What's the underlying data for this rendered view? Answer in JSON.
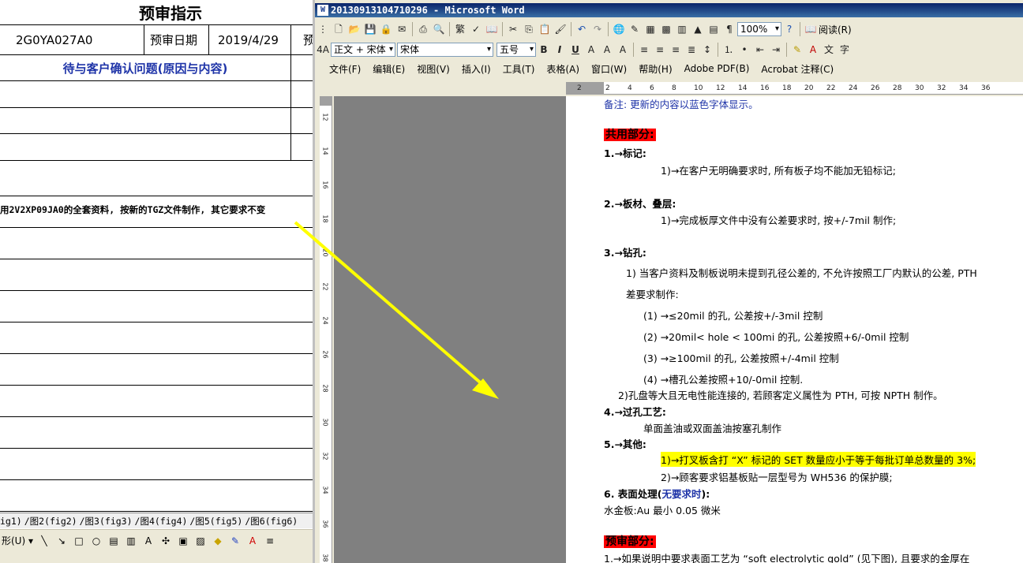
{
  "sheet": {
    "title": "预审指示",
    "part_no": "2G0YA027A0",
    "review_date_label": "预审日期",
    "review_date": "2019/4/29",
    "cut_label": "预",
    "confirm_header": "待与客户确认问题(原因与内容)",
    "note": "用2V2XP09JA0的全套资料, 按新的TGZ文件制作, 其它要求不变",
    "tabs": [
      "ig1)",
      "图2(fig2)",
      "图3(fig3)",
      "图4(fig4)",
      "图5(fig5)",
      "图6(fig6)"
    ],
    "draw_label": "形(U) ▾"
  },
  "word": {
    "title": "20130913104710296 - Microsoft Word",
    "zoom": "100%",
    "read_label": "阅读(R)",
    "style": "正文 + 宋体",
    "font": "宋体",
    "size": "五号",
    "menu": [
      "文件(F)",
      "编辑(E)",
      "视图(V)",
      "插入(I)",
      "工具(T)",
      "表格(A)",
      "窗口(W)",
      "帮助(H)",
      "Adobe PDF(B)",
      "Acrobat 注释(C)"
    ],
    "ruler_ticks": [
      "2",
      "2",
      "4",
      "6",
      "8",
      "10",
      "12",
      "14",
      "16",
      "18",
      "20",
      "22",
      "24",
      "26",
      "28",
      "30",
      "32",
      "34",
      "36"
    ],
    "vruler_ticks": [
      "12",
      "14",
      "16",
      "18",
      "20",
      "22",
      "24",
      "26",
      "28",
      "30",
      "32",
      "34",
      "36",
      "38"
    ],
    "doc": {
      "remark": "备注: 更新的内容以蓝色字体显示。",
      "common": "共用部分:",
      "s1": "1.→标记:",
      "s1_1": "1)→在客户无明确要求时, 所有板子均不能加无铅标记;",
      "s2": "2.→板材、叠层:",
      "s2_1": "1)→完成板厚文件中没有公差要求时, 按+/-7mil 制作;",
      "s3": "3.→钻孔:",
      "s3_1": "1) 当客户资料及制板说明未提到孔径公差的, 不允许按照工厂内默认的公差, PTH",
      "s3_1b": "差要求制作:",
      "s3_a": "(1) →≤20mil 的孔, 公差按+/-3mil 控制",
      "s3_b": "(2) →20mil< hole < 100mi 的孔, 公差按照+6/-0mil 控制",
      "s3_c": "(3) →≥100mil 的孔, 公差按照+/-4mil 控制",
      "s3_d": "(4) →槽孔公差按照+10/-0mil 控制.",
      "s3_2": "2)孔盘等大且无电性能连接的, 若顾客定义属性为 PTH, 可按 NPTH 制作。",
      "s4": "4.→过孔工艺:",
      "s4_1": "单面盖油或双面盖油按塞孔制作",
      "s5": "5.→其他:",
      "s5_1": "1)→打叉板含打 “X” 标记的 SET 数量应小于等于每批订单总数量的 3%;",
      "s5_2": "2)→顾客要求铝基板贴一层型号为 WH536 的保护膜;",
      "s6": "6. 表面处理(",
      "s6_req": "无要求时",
      "s6_end": "):",
      "s6_1": "水金板:Au 最小 0.05 微米",
      "prereview": "预审部分:",
      "p1": "1.→如果说明中要求表面工艺为 “soft electrolytic gold” (见下图), 且要求的金厚在"
    }
  },
  "colors": {
    "arrow": "#ffff00",
    "heading_red": "#ff0000",
    "highlight": "#ffff00",
    "blue_text": "#1f34a8"
  }
}
